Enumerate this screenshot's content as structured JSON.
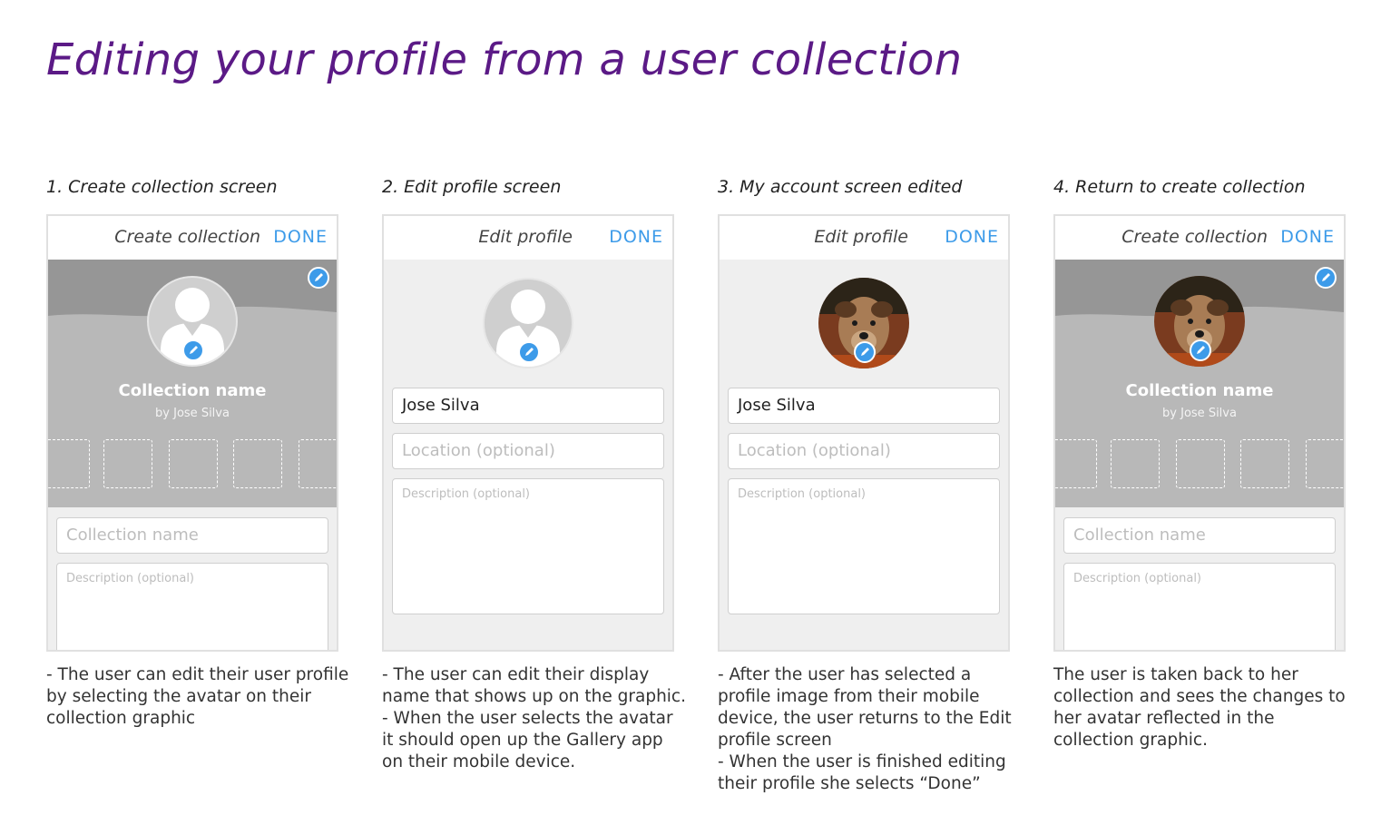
{
  "title": "Editing your profile from a user collection",
  "accent_colors": {
    "title": "#5b1a86",
    "done": "#3d9be9"
  },
  "steps": [
    {
      "title": "1. Create collection screen",
      "screen": {
        "header_title": "Create collection",
        "done_label": "DONE",
        "collection_name": "Collection name",
        "collection_by": "by Jose Silva",
        "name_placeholder": "Collection name",
        "description_placeholder": "Description (optional)",
        "avatar": "placeholder-avatar"
      },
      "description_lines": [
        "- The user can edit their user profile",
        "by selecting the avatar on their",
        "collection graphic"
      ]
    },
    {
      "title": "2. Edit profile screen",
      "screen": {
        "header_title": "Edit profile",
        "done_label": "DONE",
        "name_value": "Jose Silva",
        "location_placeholder": "Location (optional)",
        "description_placeholder": "Description (optional)",
        "avatar": "placeholder-avatar"
      },
      "description_lines": [
        "- The user can edit their display",
        "name that shows up on the graphic.",
        "- When the user selects the avatar",
        "it should open up the Gallery app",
        "on their mobile device."
      ]
    },
    {
      "title": "3. My account screen edited",
      "screen": {
        "header_title": "Edit profile",
        "done_label": "DONE",
        "name_value": "Jose Silva",
        "location_placeholder": "Location (optional)",
        "description_placeholder": "Description (optional)",
        "avatar": "dog-photo"
      },
      "description_lines": [
        "- After the user has selected a",
        "profile image from their mobile",
        "device, the user returns to the Edit",
        "profile screen",
        "- When the user is finished editing",
        "their profile she selects “Done”"
      ]
    },
    {
      "title": "4. Return to create collection",
      "screen": {
        "header_title": "Create collection",
        "done_label": "DONE",
        "collection_name": "Collection name",
        "collection_by": "by Jose Silva",
        "name_placeholder": "Collection name",
        "description_placeholder": "Description (optional)",
        "avatar": "dog-photo"
      },
      "description_lines": [
        "The user is taken back to her",
        "collection and sees the changes to",
        "her avatar reflected in the",
        "collection graphic."
      ]
    }
  ]
}
